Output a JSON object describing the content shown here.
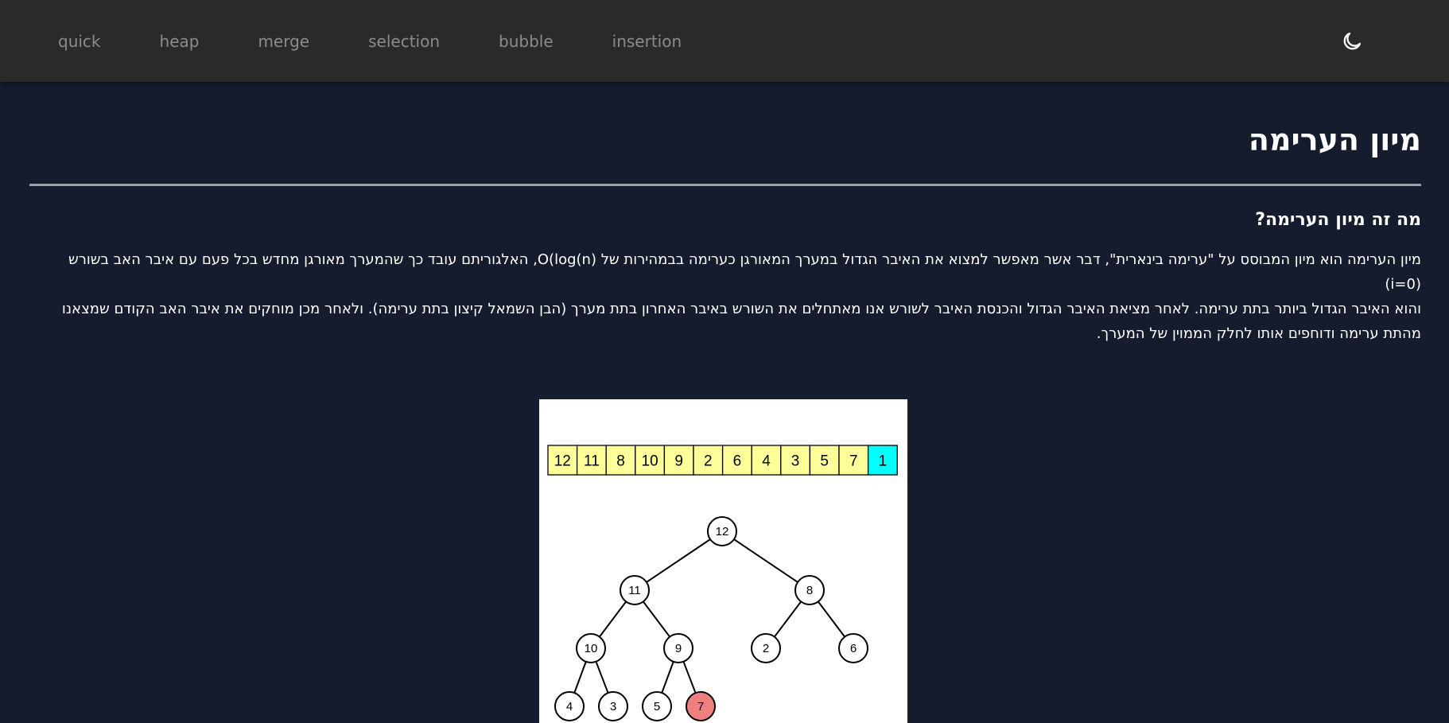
{
  "nav": {
    "links": [
      "quick",
      "heap",
      "merge",
      "selection",
      "bubble",
      "insertion"
    ],
    "theme_icon": "moon-icon"
  },
  "colors": {
    "nav_bg": "#2a2a2a",
    "page_bg": "#141c2e",
    "array_cell": "#ffff99",
    "array_sorted": "#00ffff",
    "node_highlight": "#f08080"
  },
  "main": {
    "title": "מיון הערימה",
    "subtitle": "מה זה מיון הערימה?",
    "paragraph_lines": [
      "מיון הערימה הוא מיון המבוסס על \"ערימה בינארית\", דבר אשר מאפשר למצוא את האיבר הגדול במערך המאורגן כערימה בבמהירות של O(log(n), האלגוריתם עובד כך שהמערך מאורגן מחדש בכל פעם עם איבר האב בשורש (i=0)",
      "והוא האיבר הגדול ביותר בתת ערימה. לאחר מציאת האיבר הגדול והכנסת האיבר לשורש אנו מאתחלים את השורש באיבר האחרון בתת מערך (הבן השמאל קיצון בתת ערימה). ולאחר מכן מוחקים את איבר האב הקודם שמצאנו",
      "מהתת ערימה ודוחפים אותו לחלק הממוין של המערך."
    ]
  },
  "figure": {
    "array": [
      "12",
      "11",
      "8",
      "10",
      "9",
      "2",
      "6",
      "4",
      "3",
      "5",
      "7",
      "1"
    ],
    "sorted_index": 11,
    "tree_nodes": [
      "12",
      "11",
      "8",
      "10",
      "9",
      "2",
      "6",
      "4",
      "3",
      "5",
      "7"
    ],
    "highlight_node_index": 10
  }
}
